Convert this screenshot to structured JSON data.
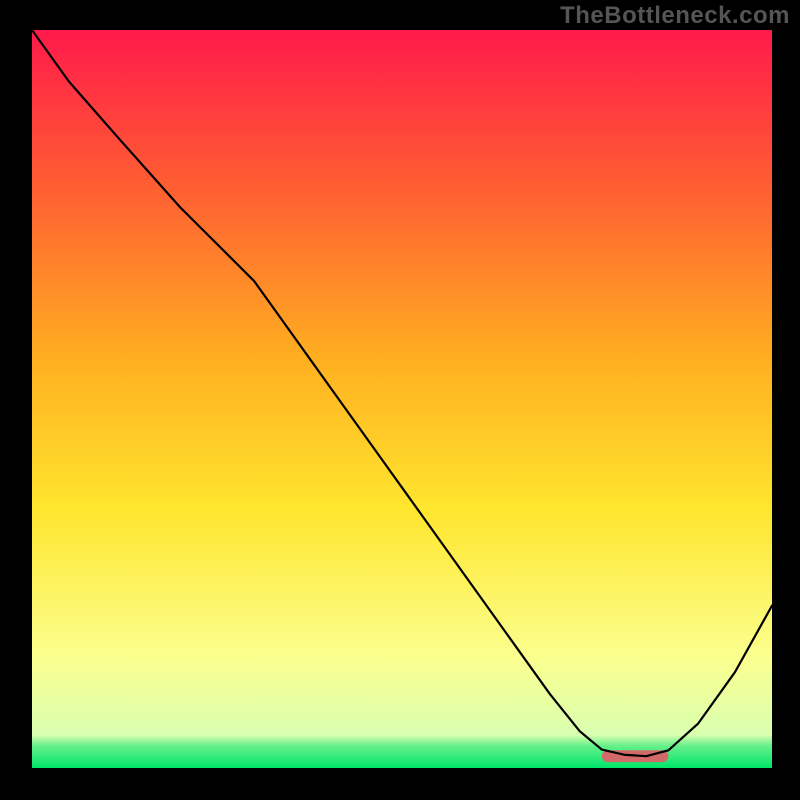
{
  "watermark": "TheBottleneck.com",
  "chart_data": {
    "type": "line",
    "title": "",
    "xlabel": "",
    "ylabel": "",
    "xlim": [
      0,
      100
    ],
    "ylim": [
      0,
      100
    ],
    "grid": false,
    "legend_position": "none",
    "background_gradient_stops": [
      {
        "offset": 0.0,
        "color": "#ff1a4b"
      },
      {
        "offset": 0.2,
        "color": "#ff5a33"
      },
      {
        "offset": 0.45,
        "color": "#ffb020"
      },
      {
        "offset": 0.65,
        "color": "#ffe62e"
      },
      {
        "offset": 0.85,
        "color": "#fbff8e"
      },
      {
        "offset": 0.955,
        "color": "#d9ffb0"
      },
      {
        "offset": 0.97,
        "color": "#66f08a"
      },
      {
        "offset": 1.0,
        "color": "#00e56a"
      }
    ],
    "series": [
      {
        "name": "curve",
        "color": "#000000",
        "width": 2.2,
        "x": [
          0,
          5,
          12,
          20,
          25,
          30,
          40,
          50,
          60,
          70,
          74,
          77,
          80,
          83,
          86,
          90,
          95,
          100
        ],
        "y": [
          100,
          93,
          85,
          76,
          71,
          66,
          52,
          38,
          24,
          10,
          5,
          2.5,
          1.8,
          1.6,
          2.4,
          6,
          13,
          22
        ]
      }
    ],
    "marker": {
      "name": "optimal-range",
      "shape": "capsule",
      "color": "#d36a6a",
      "x_start": 77,
      "x_end": 86,
      "y": 1.6,
      "height_frac": 0.016
    }
  }
}
